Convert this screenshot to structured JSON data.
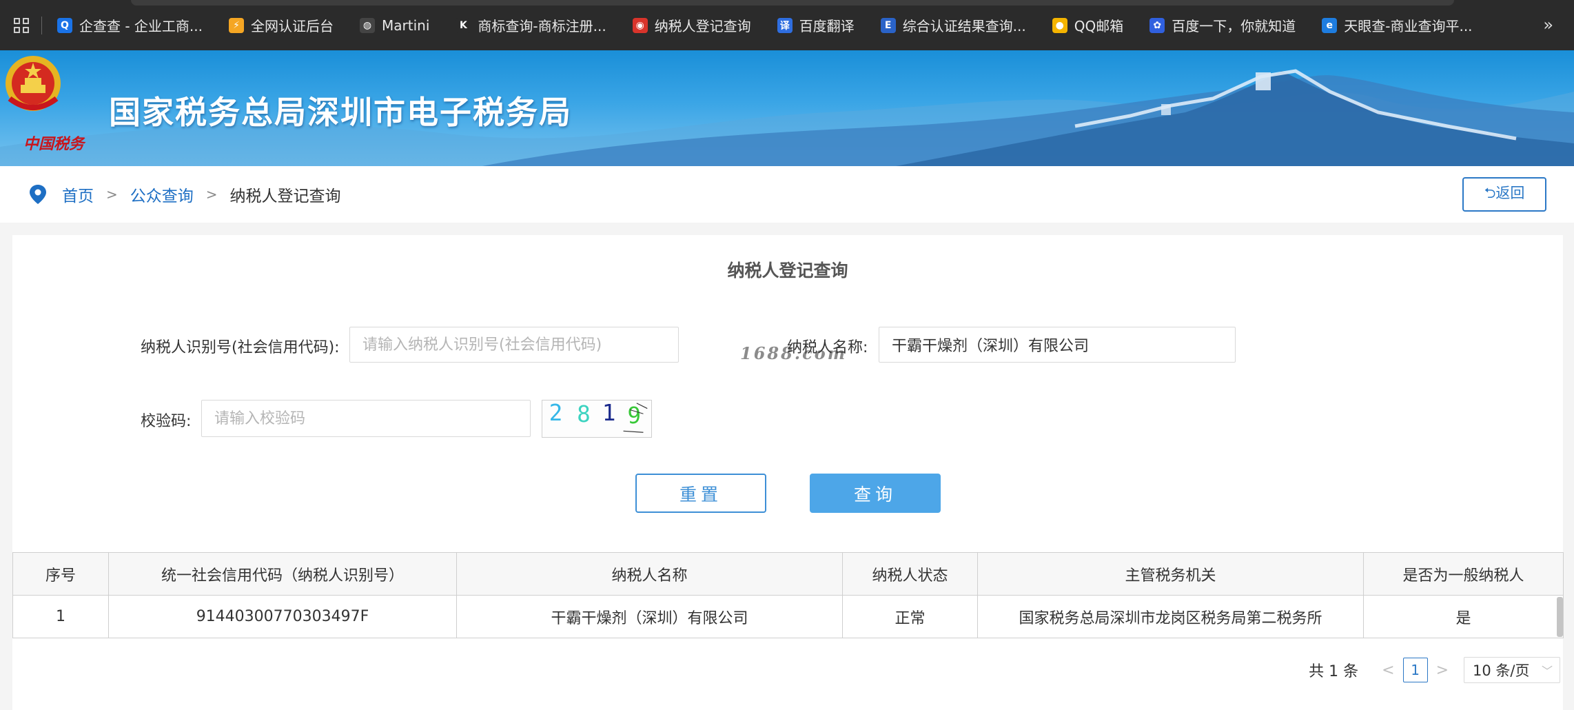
{
  "bookmarks": {
    "items": [
      {
        "label": "企查查 - 企业工商...",
        "icon": "qichacha-icon",
        "color": "#1a73e8",
        "glyph": "Q"
      },
      {
        "label": "全网认证后台",
        "icon": "auth-backend-icon",
        "color": "#f5a623",
        "glyph": "⚡"
      },
      {
        "label": "Martini",
        "icon": "globe-icon",
        "color": "#444444",
        "glyph": "◍"
      },
      {
        "label": "商标查询-商标注册...",
        "icon": "k-logo-icon",
        "color": "#2b2b2b",
        "glyph": "K"
      },
      {
        "label": "纳税人登记查询",
        "icon": "tax-emblem-icon",
        "color": "#d9342b",
        "glyph": "◉"
      },
      {
        "label": "百度翻译",
        "icon": "baidu-translate-icon",
        "color": "#2f6ee0",
        "glyph": "译"
      },
      {
        "label": "综合认证结果查询...",
        "icon": "cert-query-icon",
        "color": "#2a63c8",
        "glyph": "E"
      },
      {
        "label": "QQ邮箱",
        "icon": "qqmail-icon",
        "color": "#f4b400",
        "glyph": "●"
      },
      {
        "label": "百度一下，你就知道",
        "icon": "baidu-paw-icon",
        "color": "#3060df",
        "glyph": "✿"
      },
      {
        "label": "天眼查-商业查询平...",
        "icon": "tianyancha-icon",
        "color": "#1e7de0",
        "glyph": "e"
      }
    ],
    "more": "»"
  },
  "banner": {
    "title": "国家税务总局深圳市电子税务局",
    "slogan": "中国税务"
  },
  "breadcrumb": {
    "home": "首页",
    "sep": ">",
    "public_query": "公众查询",
    "current": "纳税人登记查询",
    "back": "⮌返回"
  },
  "form": {
    "title": "纳税人登记查询",
    "taxpayer_id_label": "纳税人识别号(社会信用代码):",
    "taxpayer_id_placeholder": "请输入纳税人识别号(社会信用代码)",
    "taxpayer_id_value": "",
    "name_label": "纳税人名称:",
    "name_value": "干霸干燥剂（深圳）有限公司",
    "captcha_label": "校验码:",
    "captcha_placeholder": "请输入校验码",
    "captcha_value": "",
    "captcha_chars": [
      "2",
      "8",
      "1",
      "9"
    ],
    "captcha_colors": [
      "#35b7e8",
      "#3cd3c0",
      "#1b2a8c",
      "#38c838"
    ],
    "watermark": "1688.com",
    "reset_label": "重置",
    "query_label": "查询"
  },
  "table": {
    "headers": [
      "序号",
      "统一社会信用代码（纳税人识别号）",
      "纳税人名称",
      "纳税人状态",
      "主管税务机关",
      "是否为一般纳税人"
    ],
    "rows": [
      [
        "1",
        "91440300770303497F",
        "干霸干燥剂（深圳）有限公司",
        "正常",
        "国家税务总局深圳市龙岗区税务局第二税务所",
        "是"
      ]
    ]
  },
  "pagination": {
    "total": "共 1 条",
    "prev": "<",
    "page": "1",
    "next": ">",
    "page_size": "10 条/页"
  },
  "colors": {
    "accent": "#2b78c6",
    "query_button": "#4da6e8",
    "bookmark_bar": "#2b2b2b",
    "banner": "#1a8fd8"
  }
}
